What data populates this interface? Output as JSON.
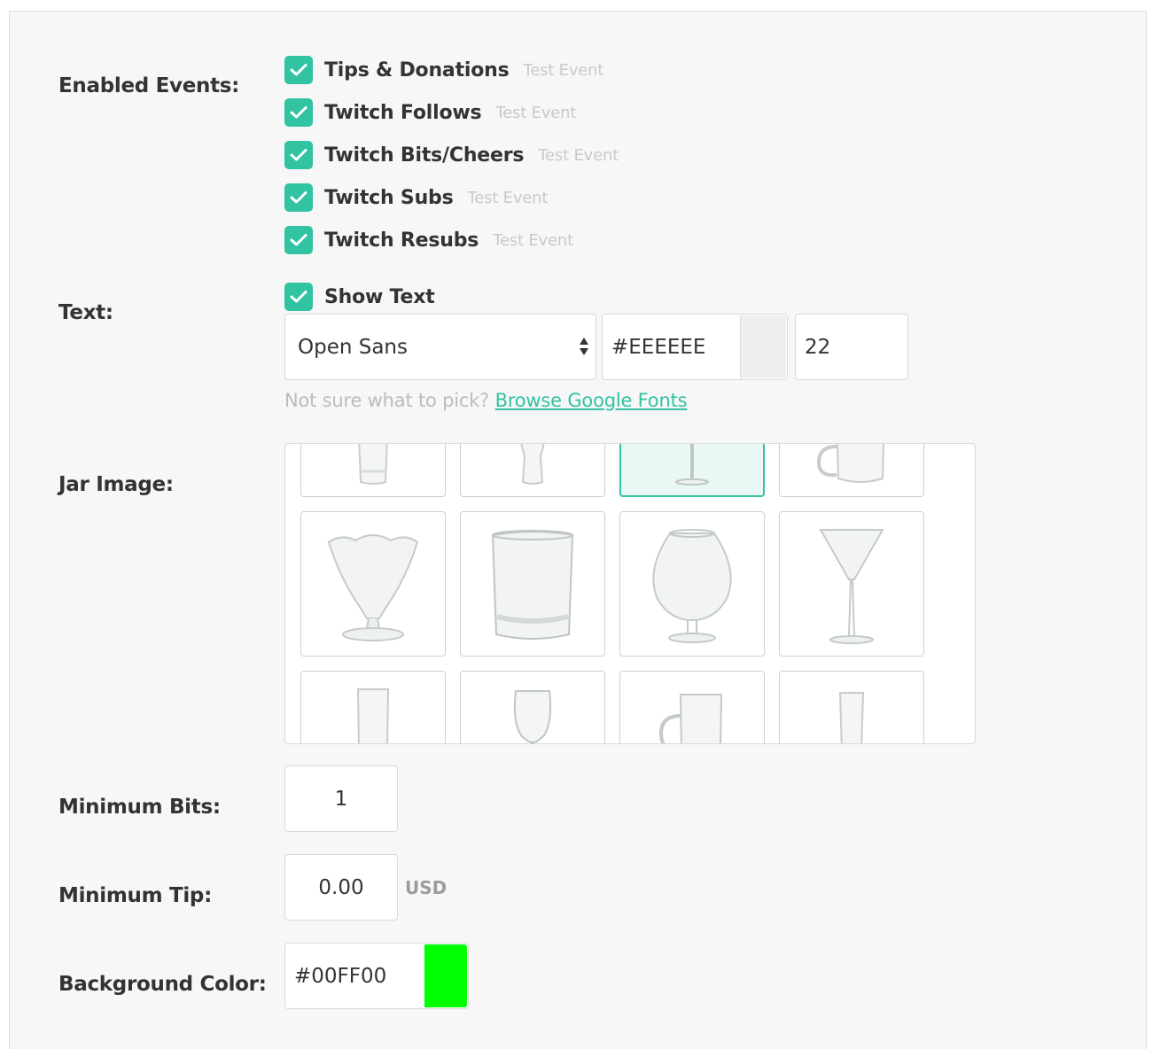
{
  "labels": {
    "enabled_events": "Enabled Events:",
    "text": "Text:",
    "jar_image": "Jar Image:",
    "minimum_bits": "Minimum Bits:",
    "minimum_tip": "Minimum Tip:",
    "background_color": "Background Color:"
  },
  "events": [
    {
      "label": "Tips & Donations",
      "checked": true,
      "test_label": "Test Event"
    },
    {
      "label": "Twitch Follows",
      "checked": true,
      "test_label": "Test Event"
    },
    {
      "label": "Twitch Bits/Cheers",
      "checked": true,
      "test_label": "Test Event"
    },
    {
      "label": "Twitch Subs",
      "checked": true,
      "test_label": "Test Event"
    },
    {
      "label": "Twitch Resubs",
      "checked": true,
      "test_label": "Test Event"
    }
  ],
  "text_settings": {
    "show_text_label": "Show Text",
    "show_text_checked": true,
    "font": "Open Sans",
    "color": "#EEEEEE",
    "size": "22",
    "hint_prefix": "Not sure what to pick?",
    "hint_link": "Browse Google Fonts"
  },
  "jar_images": {
    "selected": "wine-glass",
    "items": [
      "tumbler-glass",
      "pint-glass",
      "wine-glass",
      "beer-mug",
      "sundae-glass",
      "rocks-glass",
      "brandy-snifter",
      "martini-glass",
      "highball-glass",
      "goblet-glass",
      "glass-mug",
      "pilsner-glass"
    ]
  },
  "minimum_bits": "1",
  "minimum_tip": "0.00",
  "currency": "USD",
  "background_color": "#00FF00",
  "colors": {
    "accent": "#31c3a2",
    "text_swatch": "#eeeeee",
    "background_swatch": "#00ff00"
  }
}
